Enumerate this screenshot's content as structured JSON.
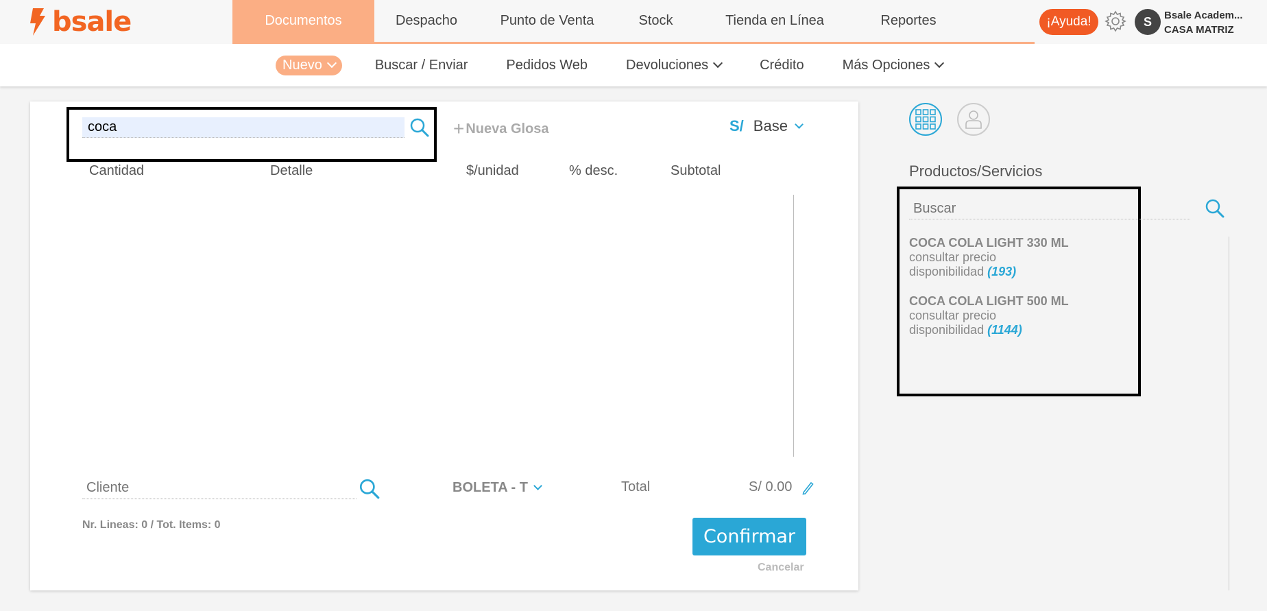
{
  "brand": {
    "name": "bsale",
    "color": "#f26522"
  },
  "main_nav": [
    {
      "label": "Documentos",
      "active": true
    },
    {
      "label": "Despacho",
      "active": false
    },
    {
      "label": "Punto de Venta",
      "active": false
    },
    {
      "label": "Stock",
      "active": false
    },
    {
      "label": "Tienda en Línea",
      "active": false
    },
    {
      "label": "Reportes",
      "active": false
    }
  ],
  "help_label": "¡Ayuda!",
  "user": {
    "initial": "S",
    "name": "Bsale Academ...",
    "branch": "CASA MATRIZ"
  },
  "sub_nav": [
    {
      "label": "Nuevo",
      "dropdown": true,
      "active": true
    },
    {
      "label": "Buscar / Enviar",
      "dropdown": false
    },
    {
      "label": "Pedidos Web",
      "dropdown": false
    },
    {
      "label": "Devoluciones",
      "dropdown": true
    },
    {
      "label": "Crédito",
      "dropdown": false
    },
    {
      "label": "Más Opciones",
      "dropdown": true
    }
  ],
  "editor": {
    "search_value": "coca",
    "new_gloss_label": "Nueva Glosa",
    "currency_symbol": "S/",
    "price_list": "Base",
    "columns": [
      "Cantidad",
      "Detalle",
      "$/unidad",
      "% desc.",
      "Subtotal"
    ],
    "client_placeholder": "Cliente",
    "doc_type": "BOLETA - T",
    "total_label": "Total",
    "total_value": "S/ 0.00",
    "lines_info": "Nr. Lineas: 0 / Tot. Items: 0",
    "confirm_label": "Confirmar",
    "cancel_label": "Cancelar"
  },
  "products_panel": {
    "title": "Productos/Servicios",
    "search_placeholder": "Buscar",
    "items": [
      {
        "name": "COCA COLA LIGHT 330 ML",
        "price": "consultar precio",
        "availability_label": "disponibilidad",
        "availability": "(193)"
      },
      {
        "name": "COCA COLA LIGHT 500 ML",
        "price": "consultar precio",
        "availability_label": "disponibilidad",
        "availability": "(1144)"
      }
    ]
  },
  "colors": {
    "accent": "#2aa7d6",
    "nav_active": "#fbae84",
    "help": "#f15a24"
  }
}
